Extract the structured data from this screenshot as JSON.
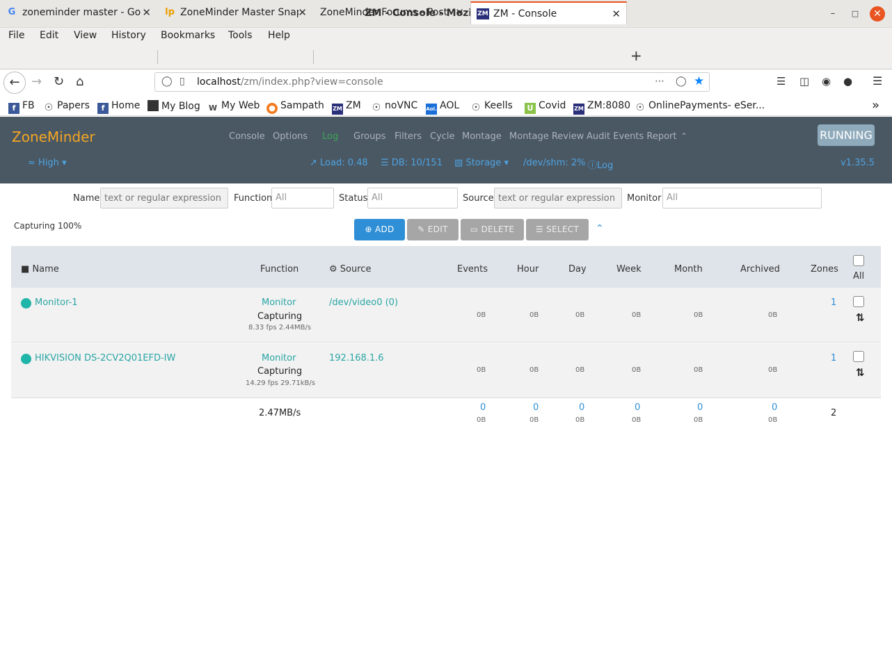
{
  "window": {
    "title": "ZM - Console - Mozilla Firefox"
  },
  "menu": [
    "File",
    "Edit",
    "View",
    "History",
    "Bookmarks",
    "Tools",
    "Help"
  ],
  "tabs": [
    {
      "label": "zoneminder master - Goo",
      "icon": "google-icon"
    },
    {
      "label": "ZoneMinder Master Snap",
      "icon": "launchpad-icon"
    },
    {
      "label": "ZoneMinder Forums - Post a",
      "icon": ""
    },
    {
      "label": "ZM - Console",
      "icon": "zm-icon",
      "active": true
    }
  ],
  "url": {
    "host": "localhost",
    "path": "/zm/index.php?view=console"
  },
  "bookmarks": [
    "FB",
    "Papers",
    "Home",
    "My Blog",
    "My Web",
    "Sampath",
    "ZM",
    "noVNC",
    "AOL",
    "Keells",
    "Covid",
    "ZM:8080",
    "OnlinePayments- eSer..."
  ],
  "zm": {
    "logo": "ZoneMinder",
    "nav": [
      "Console",
      "Options",
      "Log",
      "Groups",
      "Filters",
      "Cycle",
      "Montage",
      "Montage Review",
      "Audit Events Report"
    ],
    "state": "RUNNING",
    "bandwidth": "High",
    "load": "Load: 0.48",
    "db": "DB: 10/151",
    "storage": "Storage",
    "shm": "/dev/shm: 2%",
    "log": "Log",
    "version": "v1.35.5"
  },
  "filters": {
    "name_label": "Name",
    "name_placeholder": "text or regular expression",
    "function_label": "Function",
    "function_value": "All",
    "status_label": "Status",
    "status_value": "All",
    "source_label": "Source",
    "source_placeholder": "text or regular expression",
    "monitor_label": "Monitor",
    "monitor_value": "All"
  },
  "capturing": "Capturing 100%",
  "actions": {
    "add": "ADD",
    "edit": "EDIT",
    "delete": "DELETE",
    "select": "SELECT"
  },
  "table": {
    "headers": {
      "name": "Name",
      "function": "Function",
      "source": "Source",
      "events": "Events",
      "hour": "Hour",
      "day": "Day",
      "week": "Week",
      "month": "Month",
      "archived": "Archived",
      "zones": "Zones",
      "all": "All"
    },
    "rows": [
      {
        "name": "Monitor-1",
        "function": "Monitor",
        "status": "Capturing",
        "rate": "8.33 fps 2.44MB/s",
        "source": "/dev/video0 (0)",
        "events": "0B",
        "hour": "0B",
        "day": "0B",
        "week": "0B",
        "month": "0B",
        "archived": "0B",
        "zones": "1"
      },
      {
        "name": "HIKVISION DS-2CV2Q01EFD-IW",
        "function": "Monitor",
        "status": "Capturing",
        "rate": "14.29 fps 29.71kB/s",
        "source": "192.168.1.6",
        "events": "0B",
        "hour": "0B",
        "day": "0B",
        "week": "0B",
        "month": "0B",
        "archived": "0B",
        "zones": "1"
      }
    ],
    "footer": {
      "bandwidth": "2.47MB/s",
      "count": "0",
      "size": "0B",
      "zones": "2"
    }
  }
}
